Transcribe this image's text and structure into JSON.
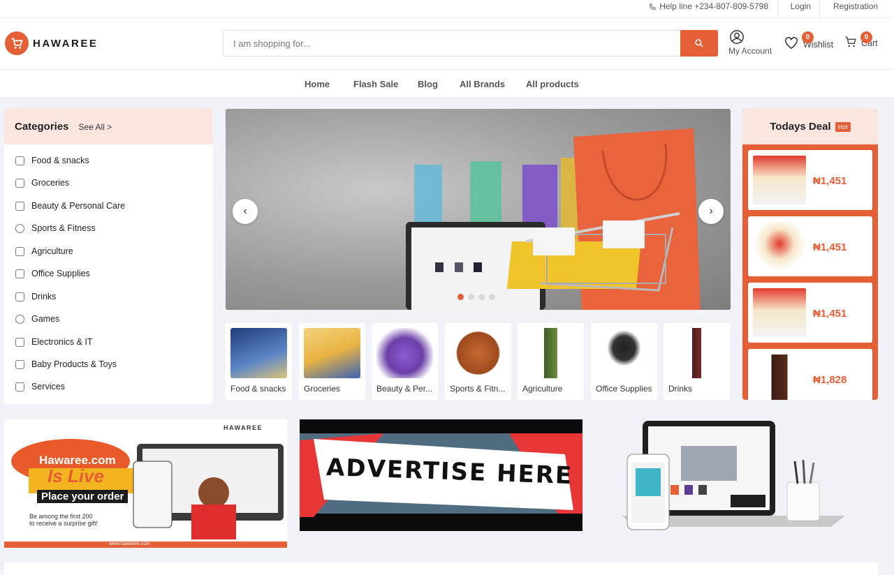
{
  "topbar": {
    "help": "Help line +234-807-809-5798",
    "login": "Login",
    "registration": "Registration"
  },
  "header": {
    "logo_text": "HAWAREE",
    "search_placeholder": "I am shopping for...",
    "account_label": "My Account",
    "wishlist_label": "Wishlist",
    "wishlist_count": "0",
    "cart_label": "Cart",
    "cart_count": "0"
  },
  "nav": [
    "Home",
    "Flash Sale",
    "Blog",
    "All Brands",
    "All products"
  ],
  "categories": {
    "title": "Categories",
    "see_all": "See All >",
    "items": [
      "Food & snacks",
      "Groceries",
      "Beauty & Personal Care",
      "Sports & Fitness",
      "Agriculture",
      "Office Supplies",
      "Drinks",
      "Games",
      "Electronics & IT",
      "Baby Products & Toys",
      "Services"
    ]
  },
  "hero": {
    "prev": "‹",
    "next": "›",
    "slides": 4,
    "active": 1
  },
  "category_tiles": [
    "Food & snacks",
    "Groceries",
    "Beauty & Per...",
    "Sports & Fitn...",
    "Agriculture",
    "Office Supplies",
    "Drinks"
  ],
  "todays_deal": {
    "title": "Todays Deal",
    "badge": "Hot",
    "prices": [
      "₦1,451",
      "₦1,451",
      "₦1,451",
      "₦1,828"
    ]
  },
  "banners": {
    "left_brand": "HAWAREE",
    "left_line1": "Hawaree.com",
    "left_line2": "Is Live",
    "left_line3": "Place your order",
    "left_line4": "Be among the first 200",
    "left_line5": "to receive a surprise gift!",
    "left_url": "www.hawaree.com",
    "middle": "ADVERTISE HERE"
  },
  "colors": {
    "accent": "#e45f35",
    "soft_accent": "#fbe6df",
    "page_bg": "#f1f2f7"
  }
}
